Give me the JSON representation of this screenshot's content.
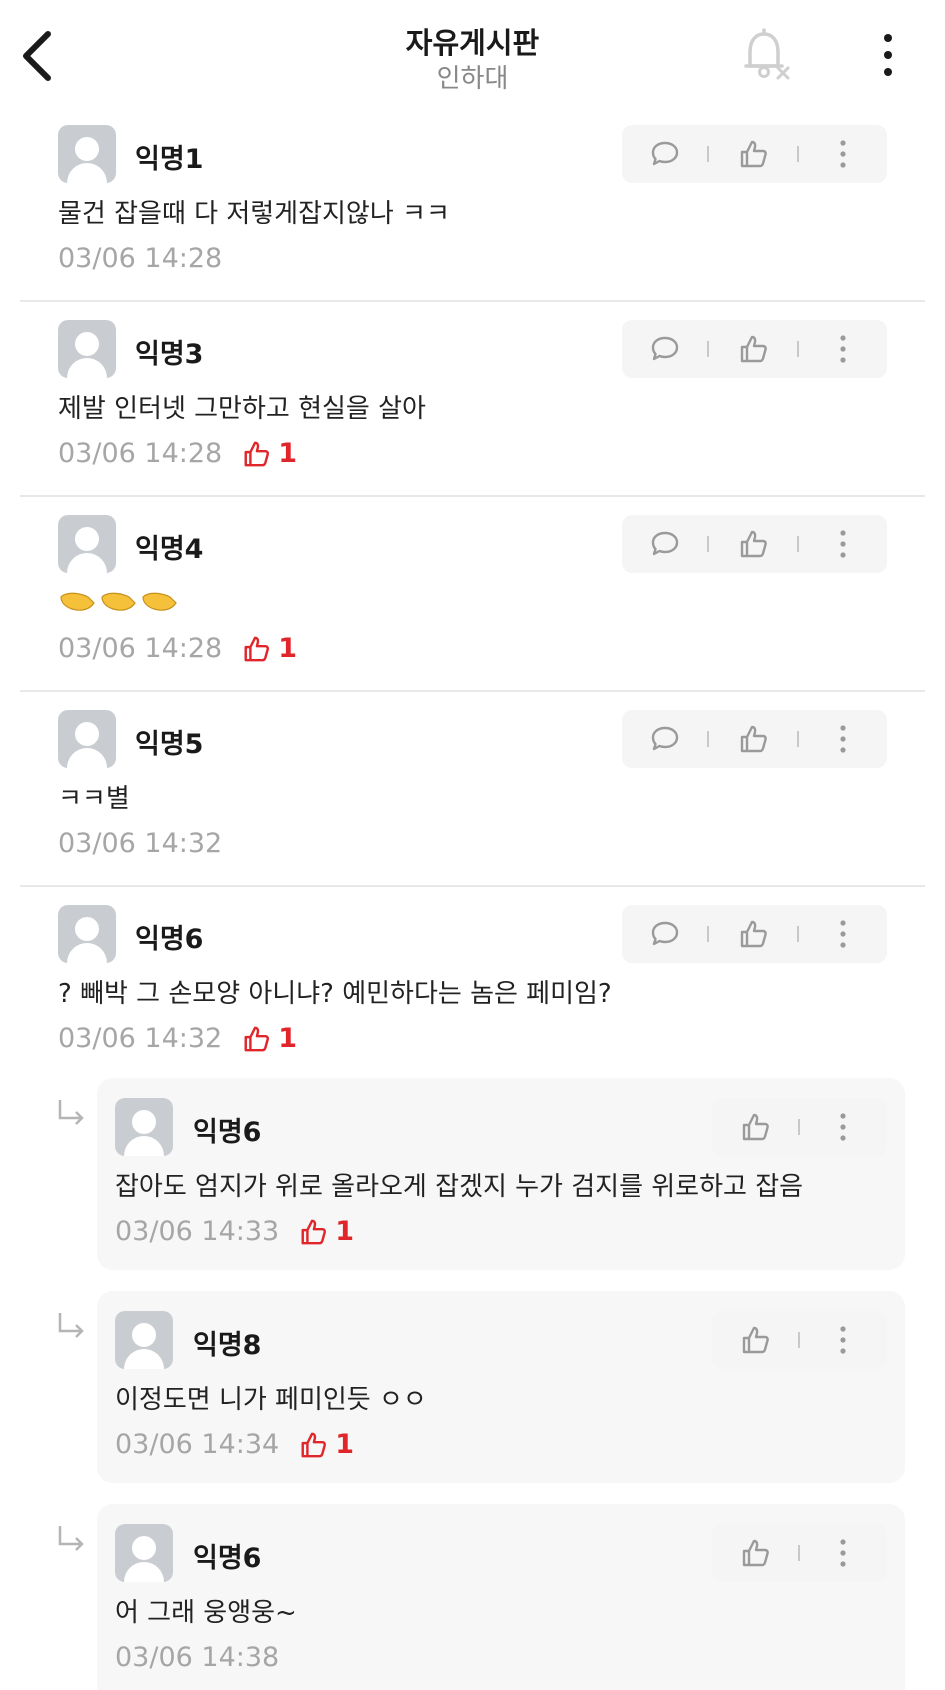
{
  "header": {
    "title": "자유게시판",
    "subtitle": "인하대"
  },
  "comments": [
    {
      "nickname": "익명1",
      "text": "물건 잡을때 다 저렇게잡지않나 ㅋㅋ",
      "time": "03/06 14:28",
      "likes": null
    },
    {
      "nickname": "익명3",
      "text": "제발 인터넷 그만하고 현실을 살아",
      "time": "03/06 14:28",
      "likes": "1"
    },
    {
      "nickname": "익명4",
      "text": "🤏🤏🤏",
      "time": "03/06 14:28",
      "likes": "1"
    },
    {
      "nickname": "익명5",
      "text": "ㅋㅋ별",
      "time": "03/06 14:32",
      "likes": null
    },
    {
      "nickname": "익명6",
      "text": "? 빼박 그 손모양 아니냐? 예민하다는 놈은 페미임?",
      "time": "03/06 14:32",
      "likes": "1"
    }
  ],
  "replies": [
    {
      "nickname": "익명6",
      "text": "잡아도 엄지가 위로 올라오게 잡겠지 누가 검지를 위로하고 잡음",
      "time": "03/06 14:33",
      "likes": "1"
    },
    {
      "nickname": "익명8",
      "text": "이정도면 니가 페미인듯 ㅇㅇ",
      "time": "03/06 14:34",
      "likes": "1"
    },
    {
      "nickname": "익명6",
      "text": "어 그래 웅앵웅~",
      "time": "03/06 14:38",
      "likes": null
    }
  ],
  "colors": {
    "like_red": "#e0262a",
    "meta_gray": "#a6a6a6",
    "action_bg": "#f5f5f5",
    "reply_bg": "#f7f7f7",
    "avatar_gray": "#c9ccd0"
  },
  "icons": [
    "back-chevron-icon",
    "bell-off-icon",
    "more-vertical-icon",
    "speech-bubble-icon",
    "thumbs-up-icon",
    "reply-arrow-icon"
  ]
}
